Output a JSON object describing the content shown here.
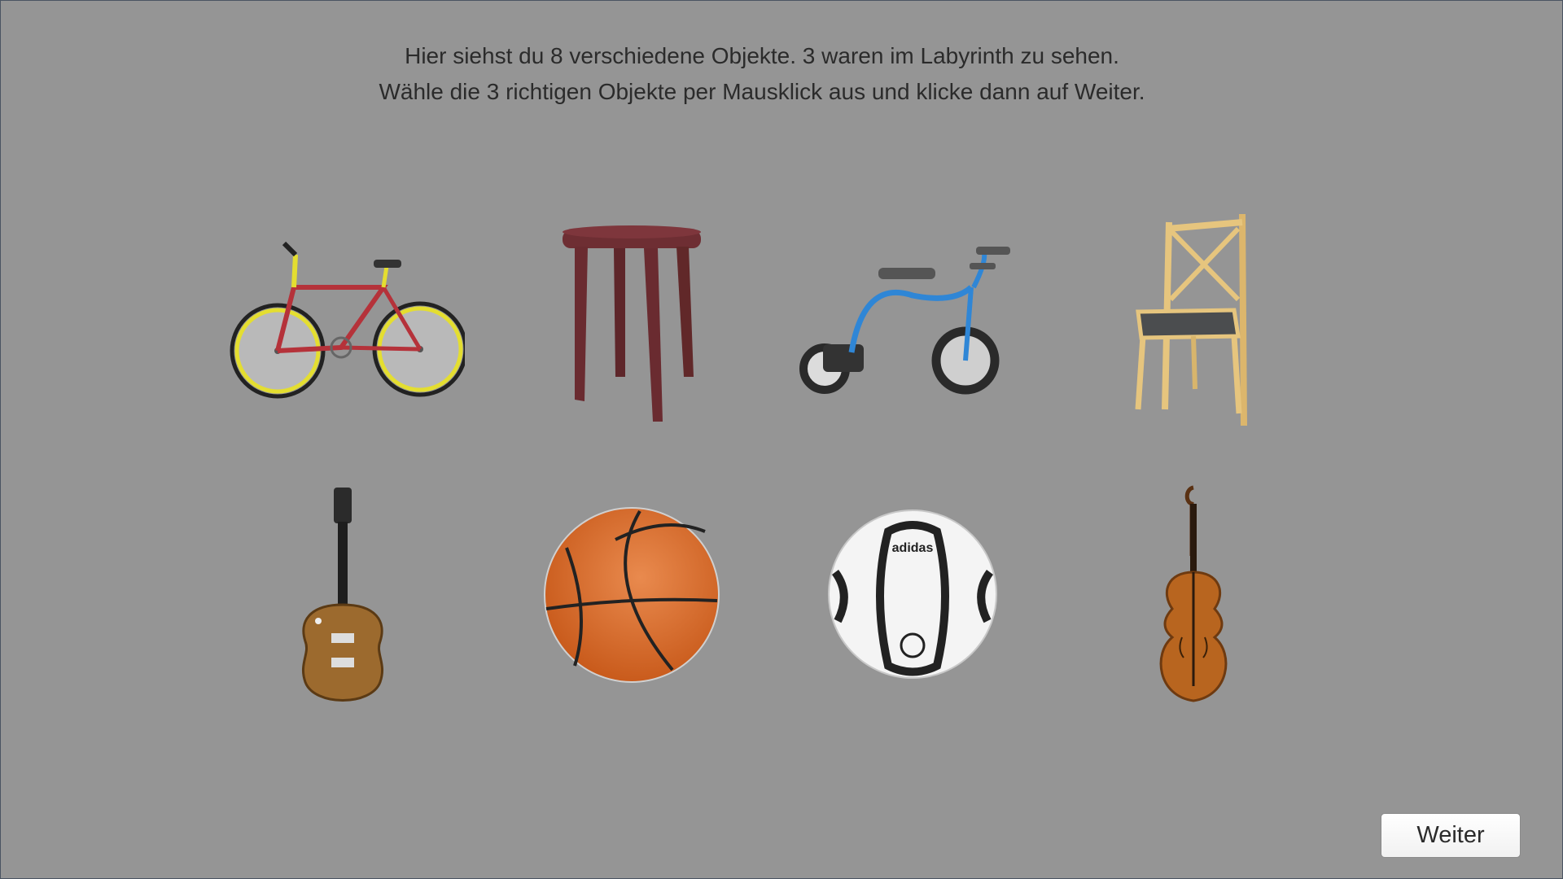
{
  "instructions": {
    "line1": "Hier siehst du 8 verschiedene Objekte. 3 waren im Labyrinth zu sehen.",
    "line2": "Wähle die 3 richtigen Objekte per Mausklick aus und klicke dann auf Weiter."
  },
  "objects": [
    {
      "name": "bicycle",
      "icon": "bicycle-icon"
    },
    {
      "name": "stool",
      "icon": "stool-icon"
    },
    {
      "name": "tricycle",
      "icon": "tricycle-icon"
    },
    {
      "name": "chair",
      "icon": "chair-icon"
    },
    {
      "name": "electric-guitar",
      "icon": "guitar-icon"
    },
    {
      "name": "basketball",
      "icon": "basketball-icon"
    },
    {
      "name": "soccer-ball",
      "icon": "soccer-ball-icon",
      "brand_text": "adidas"
    },
    {
      "name": "violin",
      "icon": "violin-icon"
    }
  ],
  "next_button": {
    "label": "Weiter"
  },
  "colors": {
    "background": "#959595",
    "bike_frame": "#b5323a",
    "bike_accent": "#e8e02a",
    "stool": "#6e2e33",
    "tricycle_frame": "#2f86d6",
    "chair_wood": "#e6c57e",
    "basketball": "#e06a22"
  }
}
